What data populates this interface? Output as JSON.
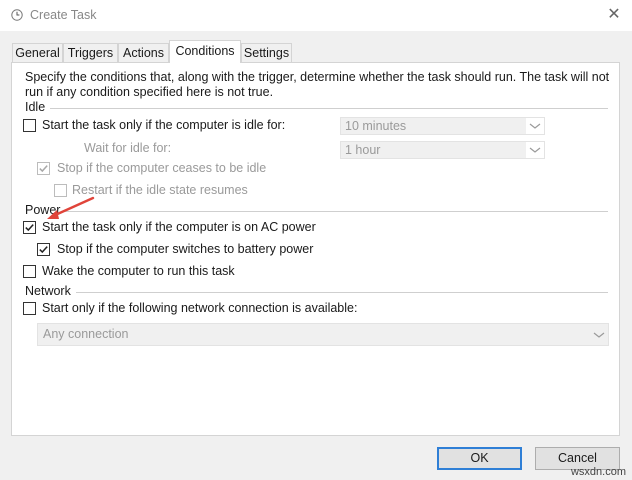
{
  "window": {
    "title": "Create Task",
    "icon": "clock-icon",
    "close_icon": "close-icon"
  },
  "tabs": [
    {
      "label": "General",
      "active": false
    },
    {
      "label": "Triggers",
      "active": false
    },
    {
      "label": "Actions",
      "active": false
    },
    {
      "label": "Conditions",
      "active": true
    },
    {
      "label": "Settings",
      "active": false
    }
  ],
  "conditions": {
    "description_line1": "Specify the conditions that, along with the trigger, determine whether the task should run.  The task will not",
    "description_line2": "run  if any condition specified here is not true.",
    "idle": {
      "heading": "Idle",
      "start_if_idle": {
        "label": "Start the task only if the computer is idle for:",
        "checked": false
      },
      "idle_duration": {
        "value": "10 minutes"
      },
      "wait_label": "Wait for idle for:",
      "wait_duration": {
        "value": "1 hour"
      },
      "stop_if_ceases": {
        "label": "Stop if the computer ceases to be idle",
        "checked": true,
        "enabled": false
      },
      "restart_if_resumes": {
        "label": "Restart if the idle state resumes",
        "checked": false,
        "enabled": false
      }
    },
    "power": {
      "heading": "Power",
      "ac_power": {
        "label": "Start the task only if the computer is on AC power",
        "checked": true
      },
      "battery_stop": {
        "label": "Stop if the computer switches to battery power",
        "checked": true
      },
      "wake": {
        "label": "Wake the computer to run this task",
        "checked": false
      }
    },
    "network": {
      "heading": "Network",
      "start_only_if": {
        "label": "Start only if the following network connection is available:",
        "checked": false
      },
      "connection": {
        "value": "Any connection"
      }
    }
  },
  "buttons": {
    "ok": "OK",
    "cancel": "Cancel"
  },
  "annotation": {
    "arrow_color": "#e0443a"
  },
  "watermark": "wsxdn.com",
  "colors": {
    "accent": "#2f7fd6",
    "panel": "#ffffff",
    "window": "#f0f0f0"
  }
}
